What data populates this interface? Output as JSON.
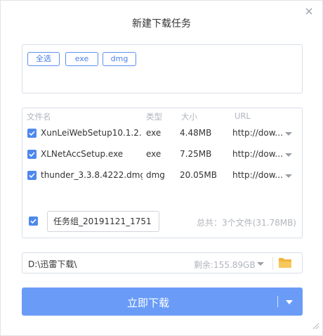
{
  "dialog": {
    "title": "新建下载任务"
  },
  "filters": [
    {
      "label": "全选"
    },
    {
      "label": "exe"
    },
    {
      "label": "dmg"
    }
  ],
  "table": {
    "headers": {
      "name": "文件名",
      "type": "类型",
      "size": "大小",
      "url": "URL"
    },
    "rows": [
      {
        "name": "XunLeiWebSetup10.1.2...",
        "type": "exe",
        "size": "4.48MB",
        "url": "http://dow...",
        "checked": true
      },
      {
        "name": "XLNetAccSetup.exe",
        "type": "exe",
        "size": "7.25MB",
        "url": "http://dow...",
        "checked": true
      },
      {
        "name": "thunder_3.3.8.4222.dmg",
        "type": "dmg",
        "size": "20.05MB",
        "url": "http://dow...",
        "checked": true
      }
    ]
  },
  "group": {
    "checked": true,
    "name_value": "任务组_20191121_1751",
    "total": "总共：3个文件(31.78MB)"
  },
  "save_path": {
    "value": "D:\\迅雷下载\\",
    "free_space": "剩余:155.89GB"
  },
  "download_button": {
    "label": "立即下载"
  },
  "colors": {
    "accent": "#4e88ee",
    "button": "#6a9cf7",
    "muted_text": "#b0b4bc",
    "folder": "#f5c24c"
  },
  "icons": {
    "close": "close-icon",
    "checkbox": "check-icon",
    "dropdown": "chevron-down-icon",
    "folder": "folder-icon",
    "resize": "resize-grip-icon"
  }
}
